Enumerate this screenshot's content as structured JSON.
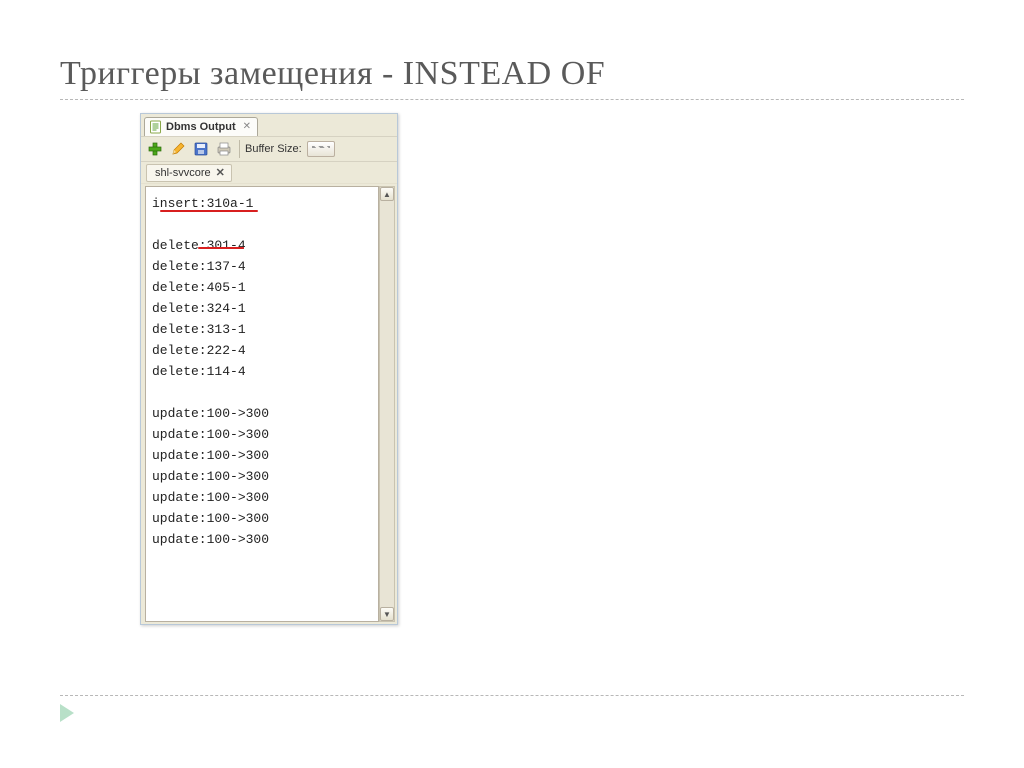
{
  "title": "Триггеры замещения - INSTEAD OF",
  "tab": {
    "label": "Dbms Output"
  },
  "toolbar": {
    "buffer_label": "Buffer Size:"
  },
  "session_tab": {
    "label": "shl-svvcore"
  },
  "output_lines": [
    "insert:310a-1",
    "",
    "delete:301-4",
    "delete:137-4",
    "delete:405-1",
    "delete:324-1",
    "delete:313-1",
    "delete:222-4",
    "delete:114-4",
    "",
    "update:100->300",
    "update:100->300",
    "update:100->300",
    "update:100->300",
    "update:100->300",
    "update:100->300",
    "update:100->300"
  ]
}
